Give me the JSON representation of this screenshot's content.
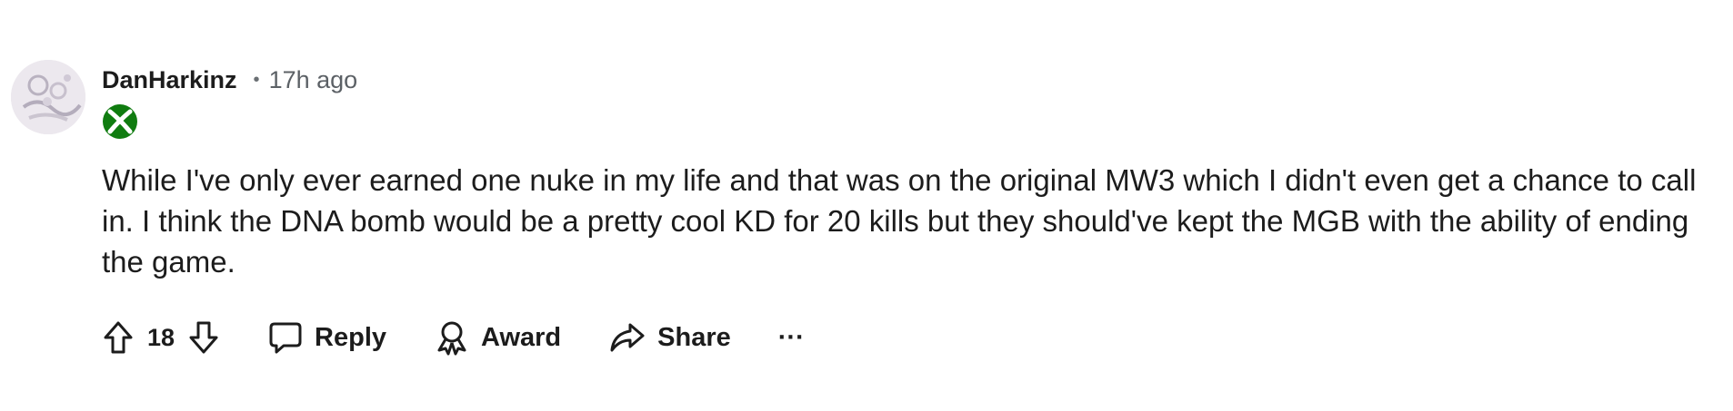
{
  "comment": {
    "author": "DanHarkinz",
    "separator": "•",
    "timestamp": "17h ago",
    "flair_icon": "xbox-icon",
    "body": "While I've only ever earned one nuke in my life and that was on the original MW3 which I didn't even get a chance to call in. I think the DNA bomb would be a pretty cool KD for 20 kills but they should've kept the MGB with the ability of ending the game."
  },
  "actions": {
    "upvote_icon": "arrow-up-icon",
    "vote_count": "18",
    "downvote_icon": "arrow-down-icon",
    "reply_icon": "speech-bubble-icon",
    "reply_label": "Reply",
    "award_icon": "award-ribbon-icon",
    "award_label": "Award",
    "share_icon": "share-arrow-icon",
    "share_label": "Share",
    "more_icon": "more-options-icon",
    "more_label": "···"
  },
  "colors": {
    "text": "#1c1c1c",
    "meta": "#5c6166",
    "xbox_green": "#107c10",
    "background": "#ffffff"
  }
}
